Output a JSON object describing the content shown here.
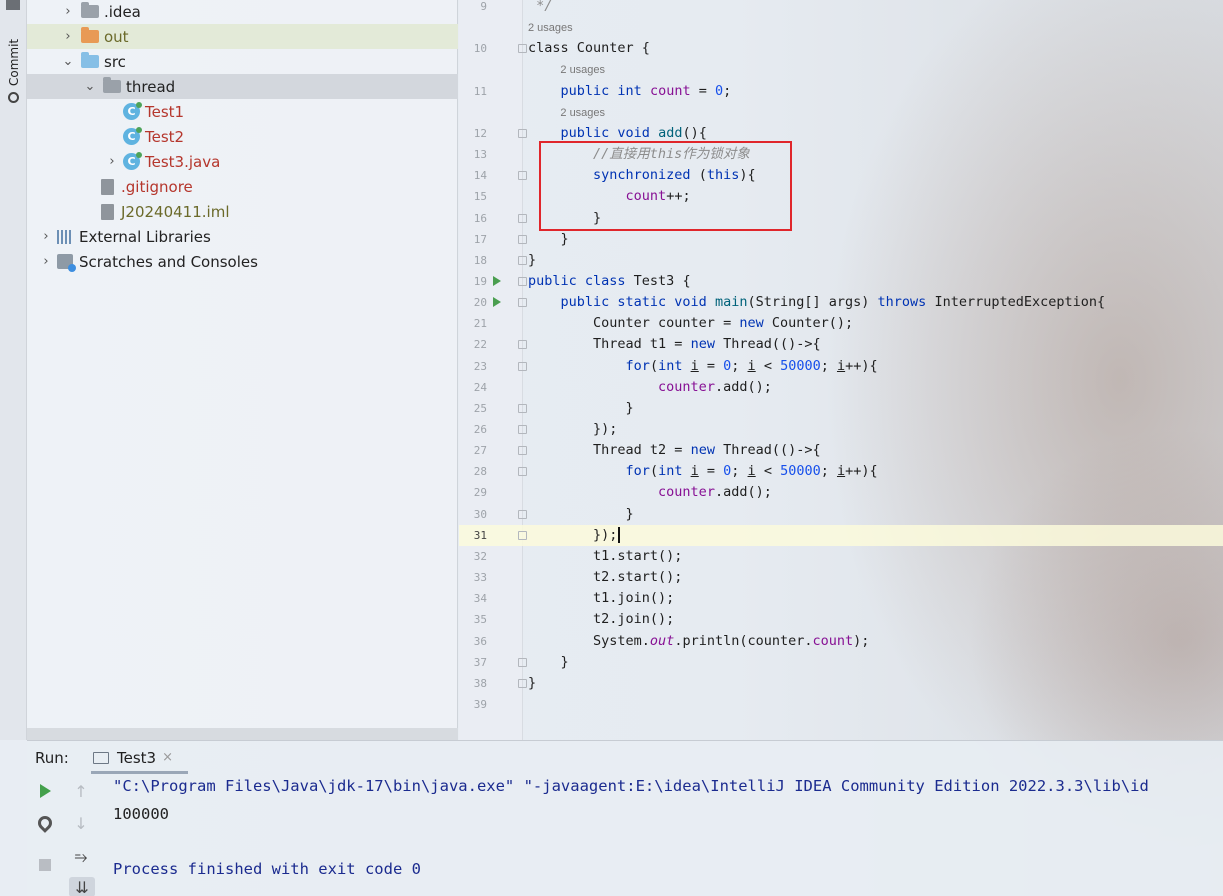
{
  "project_tree": [
    {
      "label": ".idea",
      "indent": 1,
      "chevron": "›",
      "icon": "folder-grey",
      "color": "t-dark"
    },
    {
      "label": "out",
      "indent": 1,
      "chevron": "›",
      "icon": "folder-orange",
      "color": "t-olive"
    },
    {
      "label": "src",
      "indent": 1,
      "chevron": "⌄",
      "icon": "folder-blue",
      "color": "t-dark"
    },
    {
      "label": "thread",
      "indent": 2,
      "chevron": "⌄",
      "icon": "package",
      "color": "t-dark"
    },
    {
      "label": "Test1",
      "indent": 3,
      "chevron": "",
      "icon": "class",
      "color": "t-red"
    },
    {
      "label": "Test2",
      "indent": 3,
      "chevron": "",
      "icon": "class",
      "color": "t-red"
    },
    {
      "label": "Test3.java",
      "indent": 3,
      "chevron": "›",
      "icon": "class",
      "color": "t-red"
    },
    {
      "label": ".gitignore",
      "indent": 2,
      "chevron": "",
      "icon": "file",
      "color": "t-red"
    },
    {
      "label": "J20240411.iml",
      "indent": 2,
      "chevron": "",
      "icon": "file",
      "color": "t-olive"
    },
    {
      "label": "External Libraries",
      "indent": 0,
      "chevron": "›",
      "icon": "libraries",
      "color": "t-dark"
    },
    {
      "label": "Scratches and Consoles",
      "indent": 0,
      "chevron": "›",
      "icon": "scratches",
      "color": "t-dark"
    }
  ],
  "commit_tab_label": "Commit",
  "editor": {
    "current_line": 31,
    "lines": [
      {
        "n": 9,
        "html": "<span class=\"cmt\"> */</span>"
      },
      {
        "n": 10,
        "usage": "2 usages",
        "html": "class Counter {"
      },
      {
        "n": 11,
        "usage": "2 usages",
        "html": "    <span class=\"kw\">public int</span> <span class=\"fld\">count</span> = <span class=\"num\">0</span>;"
      },
      {
        "n": 12,
        "usage": "2 usages",
        "html": "    <span class=\"kw\">public void</span> <span class=\"fn\">add</span>(){"
      },
      {
        "n": 13,
        "html": "        <span class=\"cmt\">//直接用this作为锁对象</span>"
      },
      {
        "n": 14,
        "html": "        <span class=\"kw\">synchronized</span> (<span class=\"kw\">this</span>){"
      },
      {
        "n": 15,
        "html": "            <span class=\"fld\">count</span>++;"
      },
      {
        "n": 16,
        "html": "        }"
      },
      {
        "n": 17,
        "html": "    }"
      },
      {
        "n": 18,
        "html": "}"
      },
      {
        "n": 19,
        "run": true,
        "html": "<span class=\"kw\">public class</span> Test3 {"
      },
      {
        "n": 20,
        "run": true,
        "html": "    <span class=\"kw\">public static void</span> <span class=\"fn\">main</span>(String[] args) <span class=\"kw\">throws</span> InterruptedException{"
      },
      {
        "n": 21,
        "html": "        Counter counter = <span class=\"kw\">new</span> Counter();"
      },
      {
        "n": 22,
        "html": "        Thread t1 = <span class=\"kw\">new</span> Thread(()-&gt;{"
      },
      {
        "n": 23,
        "html": "            <span class=\"kw\">for</span>(<span class=\"kw\">int</span> <u>i</u> = <span class=\"num\">0</span>; <u>i</u> &lt; <span class=\"num\">50000</span>; <u>i</u>++){"
      },
      {
        "n": 24,
        "html": "                <span class=\"fld\">counter</span>.add();"
      },
      {
        "n": 25,
        "html": "            }"
      },
      {
        "n": 26,
        "html": "        });"
      },
      {
        "n": 27,
        "html": "        Thread t2 = <span class=\"kw\">new</span> Thread(()-&gt;{"
      },
      {
        "n": 28,
        "html": "            <span class=\"kw\">for</span>(<span class=\"kw\">int</span> <u>i</u> = <span class=\"num\">0</span>; <u>i</u> &lt; <span class=\"num\">50000</span>; <u>i</u>++){"
      },
      {
        "n": 29,
        "html": "                <span class=\"fld\">counter</span>.add();"
      },
      {
        "n": 30,
        "html": "            }"
      },
      {
        "n": 31,
        "html": "        });"
      },
      {
        "n": 32,
        "html": "        t1.start();"
      },
      {
        "n": 33,
        "html": "        t2.start();"
      },
      {
        "n": 34,
        "html": "        t1.join();"
      },
      {
        "n": 35,
        "html": "        t2.join();"
      },
      {
        "n": 36,
        "html": "        System.<span class=\"it\">out</span>.println(counter.<span class=\"fld\">count</span>);"
      },
      {
        "n": 37,
        "html": "    }"
      },
      {
        "n": 38,
        "html": "}"
      },
      {
        "n": 39,
        "html": ""
      }
    ]
  },
  "run_panel": {
    "label": "Run:",
    "tab_label": "Test3",
    "tab_close": "×",
    "console": [
      "\"C:\\Program Files\\Java\\jdk-17\\bin\\java.exe\" \"-javaagent:E:\\idea\\IntelliJ IDEA Community Edition 2022.3.3\\lib\\id",
      "100000",
      "",
      "Process finished with exit code 0"
    ]
  },
  "colors": {
    "highlight_box": "#e0262b",
    "keyword": "#0033b3",
    "field": "#871094",
    "number": "#1750eb",
    "console_text": "#1b2b8f"
  }
}
